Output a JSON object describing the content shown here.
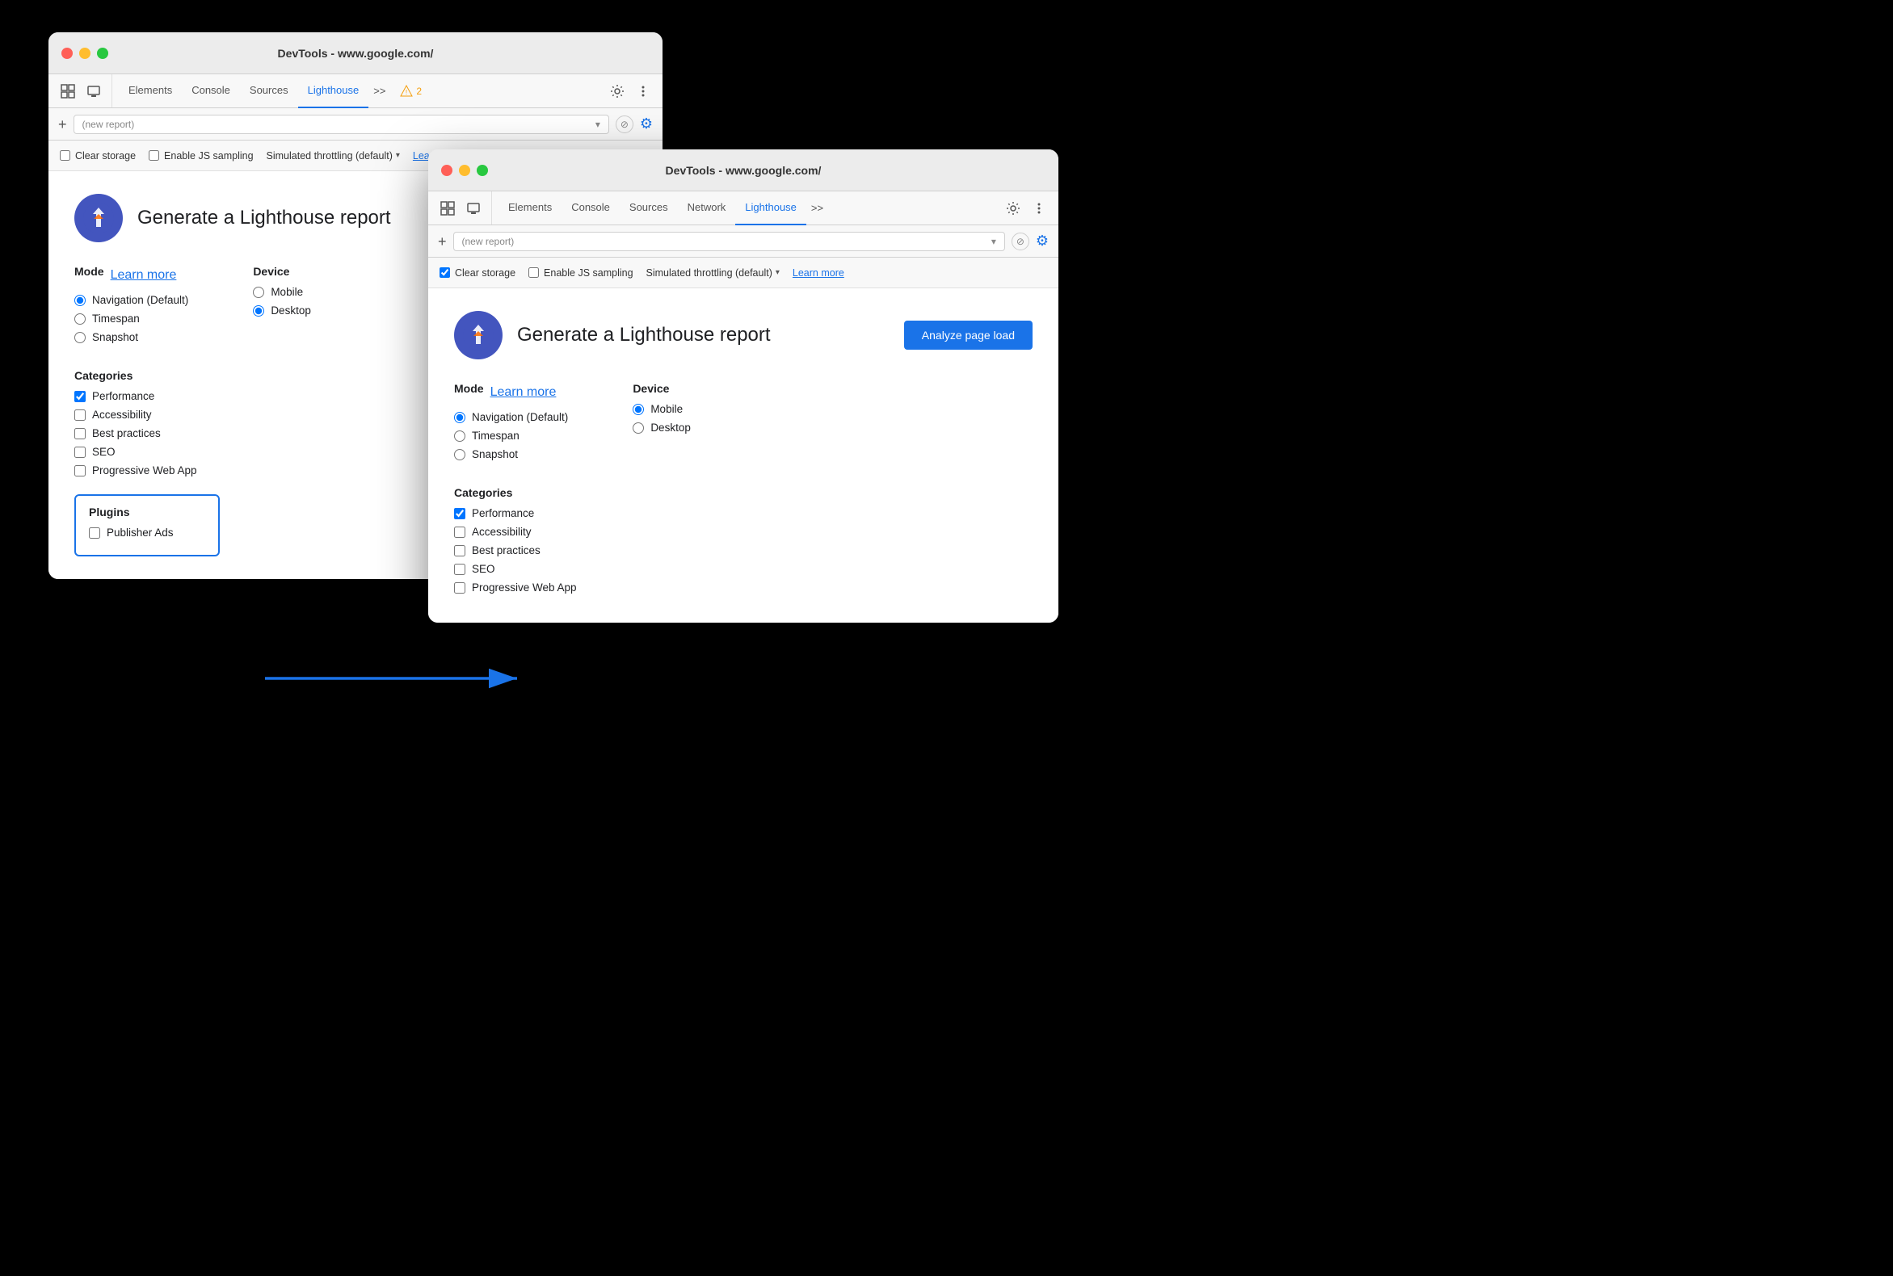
{
  "window_back": {
    "title": "DevTools - www.google.com/",
    "tabs": [
      "Elements",
      "Console",
      "Sources",
      "Lighthouse"
    ],
    "active_tab": "Lighthouse",
    "tab_more": ">>",
    "warning_count": "2",
    "address_placeholder": "(new report)",
    "options": {
      "clear_storage": false,
      "enable_js_sampling": false,
      "throttling": "Simulated throttling (default)",
      "learn_more": "Learn more"
    },
    "report_title": "Generate a Lighthouse report",
    "mode_label": "Mode",
    "learn_more": "Learn more",
    "device_label": "Device",
    "mode_options": [
      "Navigation (Default)",
      "Timespan",
      "Snapshot"
    ],
    "device_options": [
      "Mobile",
      "Desktop"
    ],
    "selected_mode": "Navigation (Default)",
    "selected_device": "Desktop",
    "categories_label": "Categories",
    "categories": [
      {
        "label": "Performance",
        "checked": true
      },
      {
        "label": "Accessibility",
        "checked": false
      },
      {
        "label": "Best practices",
        "checked": false
      },
      {
        "label": "SEO",
        "checked": false
      },
      {
        "label": "Progressive Web App",
        "checked": false
      }
    ],
    "plugins_label": "Plugins",
    "plugins": [
      {
        "label": "Publisher Ads",
        "checked": false
      }
    ]
  },
  "window_front": {
    "title": "DevTools - www.google.com/",
    "tabs": [
      "Elements",
      "Console",
      "Sources",
      "Network",
      "Lighthouse"
    ],
    "active_tab": "Lighthouse",
    "tab_more": ">>",
    "address_placeholder": "(new report)",
    "options": {
      "clear_storage": true,
      "enable_js_sampling": false,
      "throttling": "Simulated throttling (default)",
      "learn_more": "Learn more"
    },
    "report_title": "Generate a Lighthouse report",
    "analyze_btn": "Analyze page load",
    "mode_label": "Mode",
    "learn_more": "Learn more",
    "device_label": "Device",
    "mode_options": [
      "Navigation (Default)",
      "Timespan",
      "Snapshot"
    ],
    "device_options": [
      "Mobile",
      "Desktop"
    ],
    "selected_mode": "Navigation (Default)",
    "selected_device": "Mobile",
    "categories_label": "Categories",
    "categories": [
      {
        "label": "Performance",
        "checked": true
      },
      {
        "label": "Accessibility",
        "checked": false
      },
      {
        "label": "Best practices",
        "checked": false
      },
      {
        "label": "SEO",
        "checked": false
      },
      {
        "label": "Progressive Web App",
        "checked": false
      }
    ]
  },
  "arrow": {
    "label": "arrow pointing right"
  }
}
